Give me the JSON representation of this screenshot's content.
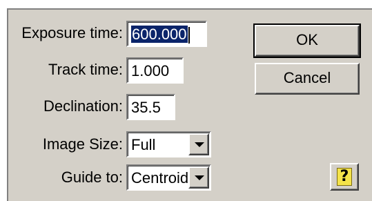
{
  "form": {
    "exposure_label": "Exposure time:",
    "exposure_value": "600.000",
    "track_label": "Track time:",
    "track_value": "1.000",
    "declination_label": "Declination:",
    "declination_value": "35.5",
    "image_size_label": "Image Size:",
    "image_size_value": "Full",
    "guide_label": "Guide to:",
    "guide_value": "Centroid"
  },
  "buttons": {
    "ok_label": "OK",
    "cancel_label": "Cancel",
    "help_glyph": "?"
  },
  "icons": {
    "dropdown": "chevron-down-icon",
    "help": "help-icon"
  },
  "colors": {
    "dialog_face": "#d4d0c8",
    "selection": "#0a246a",
    "help_icon_fill": "#f4e34a"
  }
}
